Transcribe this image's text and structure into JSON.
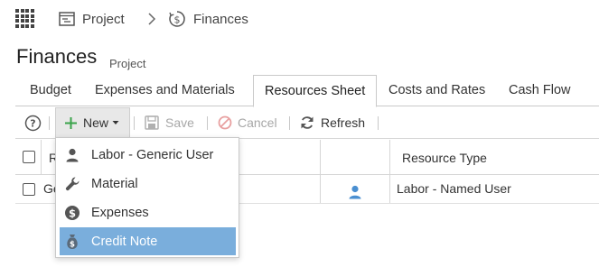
{
  "breadcrumb": {
    "project": "Project",
    "finances": "Finances"
  },
  "page": {
    "title": "Finances",
    "subtitle": "Project"
  },
  "tabs": [
    {
      "label": "Budget",
      "active": false
    },
    {
      "label": "Expenses and Materials",
      "active": false
    },
    {
      "label": "Resources Sheet",
      "active": true
    },
    {
      "label": "Costs and Rates",
      "active": false
    },
    {
      "label": "Cash Flow",
      "active": false
    }
  ],
  "toolbar": {
    "new_label": "New",
    "save_label": "Save",
    "cancel_label": "Cancel",
    "refresh_label": "Refresh"
  },
  "grid": {
    "header_col1_partial": "R",
    "header_resource_type": "Resource Type",
    "rows": [
      {
        "name_partial": "Ge",
        "resource_type": "Labor - Named User"
      }
    ]
  },
  "new_menu": {
    "items": [
      {
        "label": "Labor - Generic User",
        "icon": "user-icon",
        "highlighted": false
      },
      {
        "label": "Material",
        "icon": "wrench-icon",
        "highlighted": false
      },
      {
        "label": "Expenses",
        "icon": "dollar-coin-icon",
        "highlighted": false
      },
      {
        "label": "Credit Note",
        "icon": "money-bag-icon",
        "highlighted": true
      }
    ]
  },
  "colors": {
    "highlight": "#7aaedc",
    "accent_green": "#3aa34a",
    "user_icon_blue": "#4a8fd1",
    "cancel_icon": "#e8a0a0"
  }
}
